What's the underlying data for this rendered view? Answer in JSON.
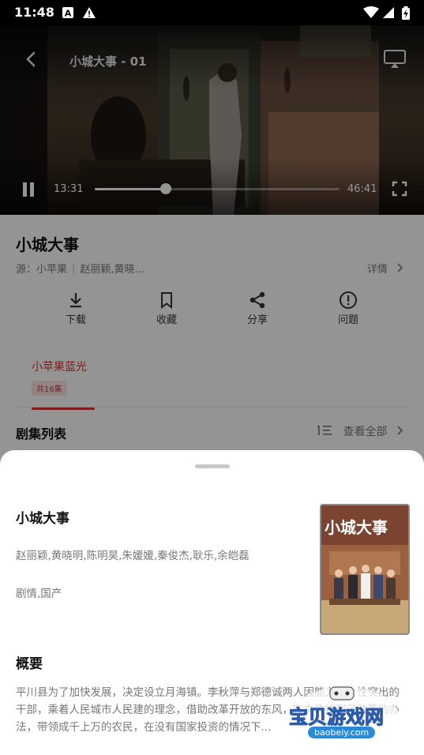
{
  "status_bar": {
    "time": "11:48"
  },
  "player": {
    "episode_title": "小城大事 - 01",
    "current_time": "13:31",
    "duration": "46:41",
    "progress": 0.29
  },
  "detail": {
    "title": "小城大事",
    "source_label": "源：小苹果",
    "cast_short": "赵丽颖,黄晓...",
    "details_link": "详情",
    "actions": [
      {
        "label": "下载",
        "icon": "download-icon"
      },
      {
        "label": "收藏",
        "icon": "bookmark-icon"
      },
      {
        "label": "分享",
        "icon": "share-icon"
      },
      {
        "label": "问题",
        "icon": "report-issue-icon"
      }
    ],
    "source_tab": {
      "name": "小苹果蓝光",
      "badge": "共16集"
    },
    "episodes_title": "剧集列表",
    "view_all": "查看全部"
  },
  "sheet": {
    "title": "小城大事",
    "cast": "赵丽颖,黄晓明,陈明昊,朱媛媛,秦俊杰,耿乐,余皑磊",
    "genre": "剧情,国产",
    "poster_title": "小城大事",
    "summary_title": "概要",
    "summary": "平川县为了加快发展，决定设立月海镇。李秋萍与郑德诚两人因能力及个性突出的干部，乘着人民城市人民建的理念，借助改革开放的东风，在文件找到了改革的办法，带领成千上万的农民，在没有国家投资的情况下..."
  },
  "watermark": {
    "text": "宝贝游戏网",
    "url": "baobeiy.com"
  },
  "colors": {
    "accent": "#dd3333",
    "muted_text": "#777777"
  }
}
